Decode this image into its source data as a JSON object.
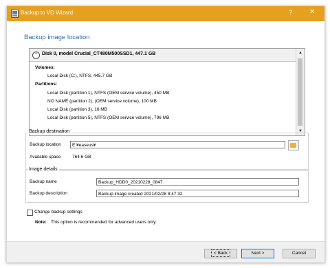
{
  "window": {
    "title": "Backup to VD Wizard",
    "help_glyph": "?",
    "close_glyph": "✕",
    "title_color": "#e6a020"
  },
  "heading": "Backup image location",
  "disk": {
    "name": "Disk 0, model Crucial_CT480M500SSD1, 447.1 GB",
    "volumes_label": "Volumes:",
    "volumes": [
      "Local Disk (C:), NTFS, 445.7 GB"
    ],
    "partitions_label": "Partitions:",
    "partitions": [
      "Local Disk (partition 1), NTFS (OEM service volume), 450 MB",
      "NO NAME (partition 2), (OEM service volume), 100 MB",
      "Local Disk (partition 3), 16 MB",
      "Local Disk (partition 5), NTFS (OEM service volume), 796 MB"
    ]
  },
  "destination": {
    "legend": "Backup destination",
    "location_label": "Backup location",
    "location_value": "E:¥easeus¥",
    "available_label": "Available space",
    "available_value": "764.6 GB"
  },
  "image": {
    "legend": "Image details",
    "name_label": "Backup name",
    "name_value": "Backup_HDD0_20210228_0847",
    "desc_label": "Backup description",
    "desc_value": "Backup image created 2021/02/28 8:47:32"
  },
  "options": {
    "change_label": "Change backup settings",
    "note_label": "Note:",
    "note_text": "This option is recommended for advanced users only."
  },
  "buttons": {
    "back": "< Back",
    "next": "Next >",
    "cancel": "Cancel"
  }
}
